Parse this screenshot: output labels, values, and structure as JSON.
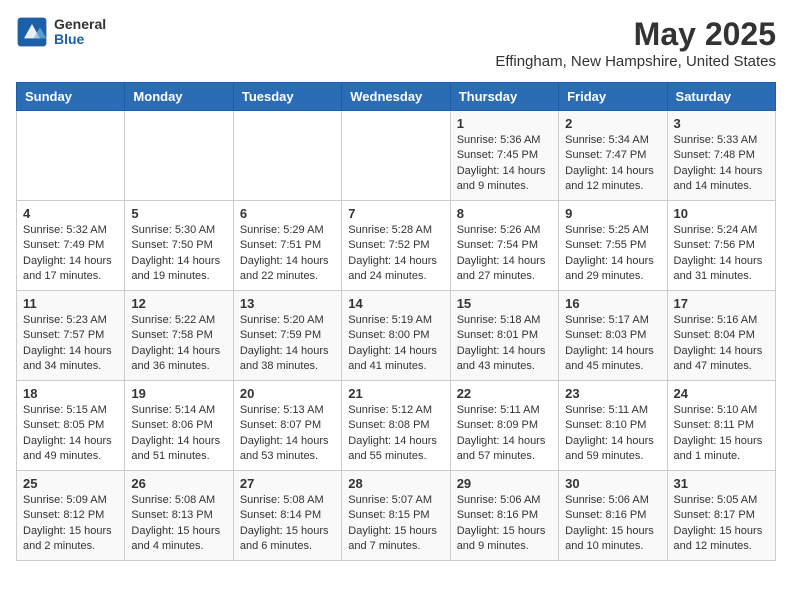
{
  "logo": {
    "general": "General",
    "blue": "Blue"
  },
  "title": "May 2025",
  "location": "Effingham, New Hampshire, United States",
  "days_of_week": [
    "Sunday",
    "Monday",
    "Tuesday",
    "Wednesday",
    "Thursday",
    "Friday",
    "Saturday"
  ],
  "weeks": [
    [
      {
        "day": "",
        "info": ""
      },
      {
        "day": "",
        "info": ""
      },
      {
        "day": "",
        "info": ""
      },
      {
        "day": "",
        "info": ""
      },
      {
        "day": "1",
        "info": "Sunrise: 5:36 AM\nSunset: 7:45 PM\nDaylight: 14 hours\nand 9 minutes."
      },
      {
        "day": "2",
        "info": "Sunrise: 5:34 AM\nSunset: 7:47 PM\nDaylight: 14 hours\nand 12 minutes."
      },
      {
        "day": "3",
        "info": "Sunrise: 5:33 AM\nSunset: 7:48 PM\nDaylight: 14 hours\nand 14 minutes."
      }
    ],
    [
      {
        "day": "4",
        "info": "Sunrise: 5:32 AM\nSunset: 7:49 PM\nDaylight: 14 hours\nand 17 minutes."
      },
      {
        "day": "5",
        "info": "Sunrise: 5:30 AM\nSunset: 7:50 PM\nDaylight: 14 hours\nand 19 minutes."
      },
      {
        "day": "6",
        "info": "Sunrise: 5:29 AM\nSunset: 7:51 PM\nDaylight: 14 hours\nand 22 minutes."
      },
      {
        "day": "7",
        "info": "Sunrise: 5:28 AM\nSunset: 7:52 PM\nDaylight: 14 hours\nand 24 minutes."
      },
      {
        "day": "8",
        "info": "Sunrise: 5:26 AM\nSunset: 7:54 PM\nDaylight: 14 hours\nand 27 minutes."
      },
      {
        "day": "9",
        "info": "Sunrise: 5:25 AM\nSunset: 7:55 PM\nDaylight: 14 hours\nand 29 minutes."
      },
      {
        "day": "10",
        "info": "Sunrise: 5:24 AM\nSunset: 7:56 PM\nDaylight: 14 hours\nand 31 minutes."
      }
    ],
    [
      {
        "day": "11",
        "info": "Sunrise: 5:23 AM\nSunset: 7:57 PM\nDaylight: 14 hours\nand 34 minutes."
      },
      {
        "day": "12",
        "info": "Sunrise: 5:22 AM\nSunset: 7:58 PM\nDaylight: 14 hours\nand 36 minutes."
      },
      {
        "day": "13",
        "info": "Sunrise: 5:20 AM\nSunset: 7:59 PM\nDaylight: 14 hours\nand 38 minutes."
      },
      {
        "day": "14",
        "info": "Sunrise: 5:19 AM\nSunset: 8:00 PM\nDaylight: 14 hours\nand 41 minutes."
      },
      {
        "day": "15",
        "info": "Sunrise: 5:18 AM\nSunset: 8:01 PM\nDaylight: 14 hours\nand 43 minutes."
      },
      {
        "day": "16",
        "info": "Sunrise: 5:17 AM\nSunset: 8:03 PM\nDaylight: 14 hours\nand 45 minutes."
      },
      {
        "day": "17",
        "info": "Sunrise: 5:16 AM\nSunset: 8:04 PM\nDaylight: 14 hours\nand 47 minutes."
      }
    ],
    [
      {
        "day": "18",
        "info": "Sunrise: 5:15 AM\nSunset: 8:05 PM\nDaylight: 14 hours\nand 49 minutes."
      },
      {
        "day": "19",
        "info": "Sunrise: 5:14 AM\nSunset: 8:06 PM\nDaylight: 14 hours\nand 51 minutes."
      },
      {
        "day": "20",
        "info": "Sunrise: 5:13 AM\nSunset: 8:07 PM\nDaylight: 14 hours\nand 53 minutes."
      },
      {
        "day": "21",
        "info": "Sunrise: 5:12 AM\nSunset: 8:08 PM\nDaylight: 14 hours\nand 55 minutes."
      },
      {
        "day": "22",
        "info": "Sunrise: 5:11 AM\nSunset: 8:09 PM\nDaylight: 14 hours\nand 57 minutes."
      },
      {
        "day": "23",
        "info": "Sunrise: 5:11 AM\nSunset: 8:10 PM\nDaylight: 14 hours\nand 59 minutes."
      },
      {
        "day": "24",
        "info": "Sunrise: 5:10 AM\nSunset: 8:11 PM\nDaylight: 15 hours\nand 1 minute."
      }
    ],
    [
      {
        "day": "25",
        "info": "Sunrise: 5:09 AM\nSunset: 8:12 PM\nDaylight: 15 hours\nand 2 minutes."
      },
      {
        "day": "26",
        "info": "Sunrise: 5:08 AM\nSunset: 8:13 PM\nDaylight: 15 hours\nand 4 minutes."
      },
      {
        "day": "27",
        "info": "Sunrise: 5:08 AM\nSunset: 8:14 PM\nDaylight: 15 hours\nand 6 minutes."
      },
      {
        "day": "28",
        "info": "Sunrise: 5:07 AM\nSunset: 8:15 PM\nDaylight: 15 hours\nand 7 minutes."
      },
      {
        "day": "29",
        "info": "Sunrise: 5:06 AM\nSunset: 8:16 PM\nDaylight: 15 hours\nand 9 minutes."
      },
      {
        "day": "30",
        "info": "Sunrise: 5:06 AM\nSunset: 8:16 PM\nDaylight: 15 hours\nand 10 minutes."
      },
      {
        "day": "31",
        "info": "Sunrise: 5:05 AM\nSunset: 8:17 PM\nDaylight: 15 hours\nand 12 minutes."
      }
    ]
  ]
}
